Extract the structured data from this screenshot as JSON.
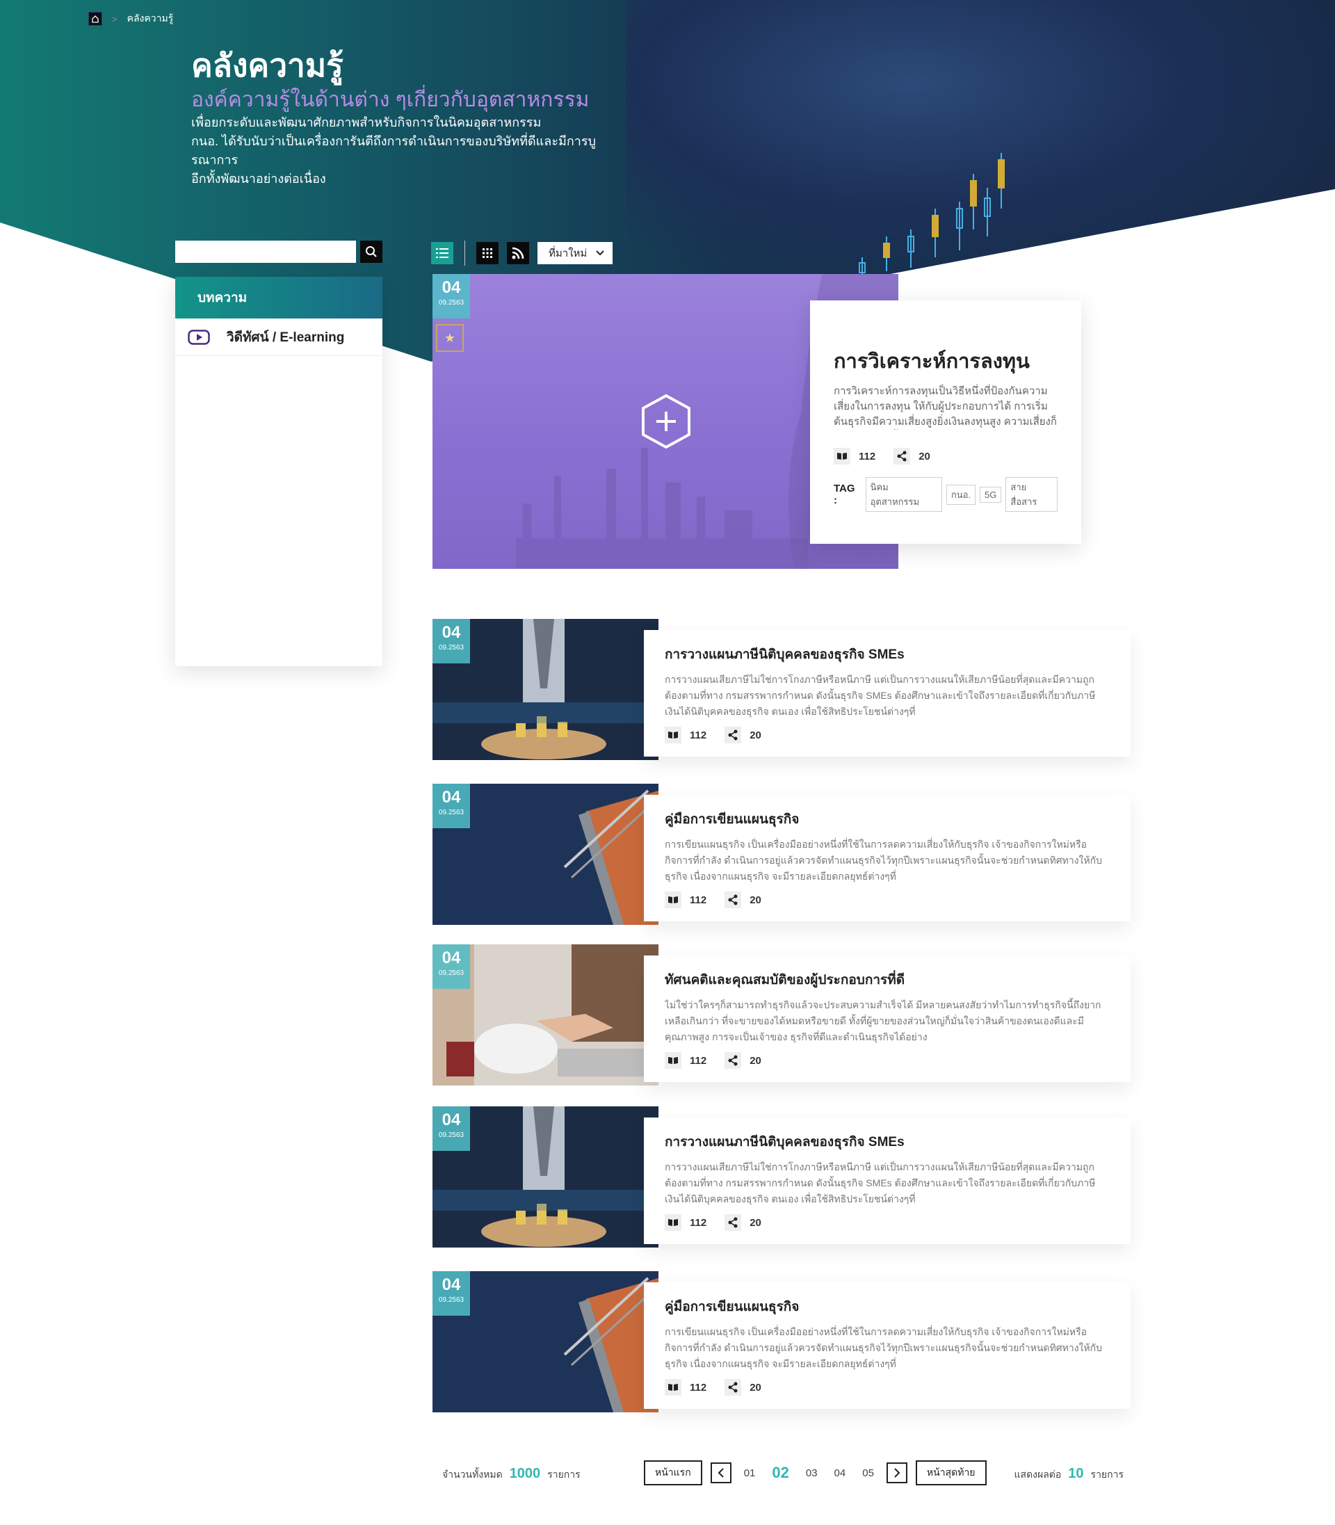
{
  "breadcrumb": {
    "current": "คลังความรู้"
  },
  "hero": {
    "title": "คลังความรู้",
    "subtitle": "องค์ความรู้ในด้านต่าง ๆเกี่ยวกับอุตสาหกรรม",
    "lines": [
      "เพื่อยกระดับและพัฒนาศักยภาพสำหรับกิจการในนิคมอุตสาหกรรม",
      "กนอ. ได้รับนับว่าเป็นเครื่องการันตีถึงการดำเนินการของบริษัทที่ดีและมีการบูรณาการ",
      "อีกทั้งพัฒนาอย่างต่อเนื่อง"
    ]
  },
  "search": {
    "placeholder": "",
    "value": ""
  },
  "sidebar": {
    "items": [
      {
        "label": "บทความ",
        "active": true
      },
      {
        "label": "วิดีทัศน์ / E-learning",
        "icon": "play-icon"
      }
    ]
  },
  "toolbar": {
    "sort_label": "ที่มาใหม่"
  },
  "featured": {
    "day": "04",
    "month": "09.2563",
    "title": "การวิเคราะห์การลงทุน",
    "desc": "การวิเคราะห์การลงทุนเป็นวิธีหนึ่งที่ป้องกันความเสี่ยงในการลงทุน ให้กับผู้ประกอบการได้ การเริ่มต้นธุรกิจมีความเสี่ยงสูงยิ่งเงินลงทุนสูง ความเสี่ยงก็ยิ่งสูงตาม ดังนั้นเจ้าของกิจการที่จะเริ่มลงทุนใน...",
    "reads": "112",
    "shares": "20",
    "tag_label": "TAG :",
    "tags": [
      "นิคมอุตสาหกรรม",
      "กนอ.",
      "5G",
      "สายสื่อสาร"
    ]
  },
  "articles": [
    {
      "day": "04",
      "month": "09.2563",
      "title": "การวางแผนภาษีนิติบุคคลของธุรกิจ SMEs",
      "desc": "การวางแผนเสียภาษีไม่ใช่การโกงภาษีหรือหนีภาษี แต่เป็นการวางแผนให้เสียภาษีน้อยที่สุดและมีความถูกต้องตามที่ทาง กรมสรรพากรกำหนด ดังนั้นธุรกิจ SMEs ต้องศึกษาและเข้าใจถึงรายละเอียดที่เกี่ยวกับภาษีเงินได้นิติบุคคลของธุรกิจ ตนเอง เพื่อใช้สิทธิประโยชน์ต่างๆที่",
      "reads": "112",
      "shares": "20",
      "img": "money"
    },
    {
      "day": "04",
      "month": "09.2563",
      "title": "คู่มือการเขียนแผนธุรกิจ",
      "desc": "การเขียนแผนธุรกิจ เป็นเครื่องมืออย่างหนึ่งที่ใช้ในการลดความเสี่ยงให้กับธุรกิจ เจ้าของกิจการใหม่หรือกิจการที่กำลัง ดำเนินการอยู่แล้วควรจัดทำแผนธุรกิจไว้ทุกปีเพราะแผนธุรกิจนั้นจะช่วยกำหนดทิศทางให้กับธุรกิจ เนื่องจากแผนธุรกิจ จะมีรายละเอียดกลยุทธ์ต่างๆที่",
      "reads": "112",
      "shares": "20",
      "img": "notebook"
    },
    {
      "day": "04",
      "month": "09.2563",
      "title": "ทัศนคติและคุณสมบัติของผู้ประกอบการที่ดี",
      "desc": "ไม่ใช่ว่าใครๆก็สามารถทำธุรกิจแล้วจะประสบความสำเร็จได้ มีหลายคนสงสัยว่าทำไมการทำธุรกิจนี้ถึงยากเหลือเกินกว่า ที่จะขายของได้หมดหรือขายดี ทั้งที่ผู้ขายของส่วนใหญ่ก็มั่นใจว่าสินค้าของตนเองดีและมีคุณภาพสูง การจะเป็นเจ้าของ ธุรกิจที่ดีและดำเนินธุรกิจได้อย่าง",
      "reads": "112",
      "shares": "20",
      "img": "handshake"
    },
    {
      "day": "04",
      "month": "09.2563",
      "title": "การวางแผนภาษีนิติบุคคลของธุรกิจ SMEs",
      "desc": "การวางแผนเสียภาษีไม่ใช่การโกงภาษีหรือหนีภาษี แต่เป็นการวางแผนให้เสียภาษีน้อยที่สุดและมีความถูกต้องตามที่ทาง กรมสรรพากรกำหนด ดังนั้นธุรกิจ SMEs ต้องศึกษาและเข้าใจถึงรายละเอียดที่เกี่ยวกับภาษีเงินได้นิติบุคคลของธุรกิจ ตนเอง เพื่อใช้สิทธิประโยชน์ต่างๆที่",
      "reads": "112",
      "shares": "20",
      "img": "money"
    },
    {
      "day": "04",
      "month": "09.2563",
      "title": "คู่มือการเขียนแผนธุรกิจ",
      "desc": "การเขียนแผนธุรกิจ เป็นเครื่องมืออย่างหนึ่งที่ใช้ในการลดความเสี่ยงให้กับธุรกิจ เจ้าของกิจการใหม่หรือกิจการที่กำลัง ดำเนินการอยู่แล้วควรจัดทำแผนธุรกิจไว้ทุกปีเพราะแผนธุรกิจนั้นจะช่วยกำหนดทิศทางให้กับธุรกิจ เนื่องจากแผนธุรกิจ จะมีรายละเอียดกลยุทธ์ต่างๆที่",
      "reads": "112",
      "shares": "20",
      "img": "notebook"
    }
  ],
  "pagination": {
    "total_label": "จำนวนทั้งหมด",
    "total": "1000",
    "unit": "รายการ",
    "first": "หน้าแรก",
    "last": "หน้าสุดท้าย",
    "pages": [
      "01",
      "02",
      "03",
      "04",
      "05"
    ],
    "current": "02",
    "perpage_label": "แสดงผลต่อ",
    "perpage": "10",
    "perpage_unit": "รายการ"
  },
  "colors": {
    "accent": "#1a9f94",
    "purple": "#b98ce6",
    "navy": "#182a48"
  }
}
